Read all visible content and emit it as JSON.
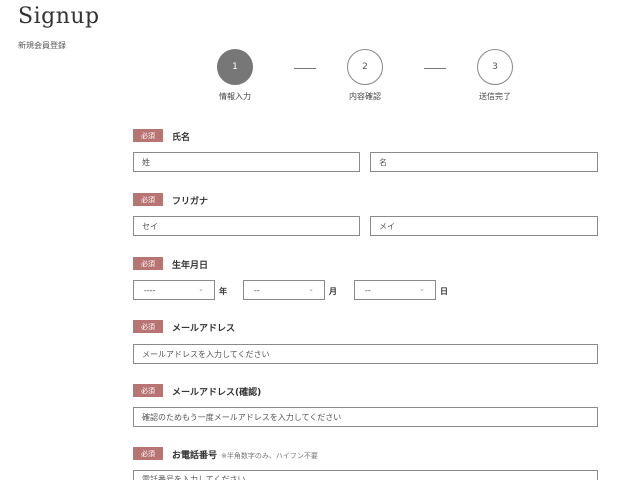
{
  "header": {
    "title": "Signup",
    "subtitle": "新規会員登録"
  },
  "stepper": {
    "steps": [
      {
        "number": "1",
        "label": "情報入力",
        "active": true
      },
      {
        "number": "2",
        "label": "内容確認",
        "active": false
      },
      {
        "number": "3",
        "label": "送信完了",
        "active": false
      }
    ]
  },
  "required_badge": "必須",
  "form": {
    "name": {
      "label": "氏名",
      "last_placeholder": "姓",
      "first_placeholder": "名"
    },
    "kana": {
      "label": "フリガナ",
      "last_placeholder": "セイ",
      "first_placeholder": "メイ"
    },
    "birthday": {
      "label": "生年月日",
      "year_value": "----",
      "year_unit": "年",
      "month_value": "--",
      "month_unit": "月",
      "day_value": "--",
      "day_unit": "日"
    },
    "email": {
      "label": "メールアドレス",
      "placeholder": "メールアドレスを入力してください"
    },
    "email_confirm": {
      "label": "メールアドレス(確認)",
      "placeholder": "確認のためもう一度メールアドレスを入力してください"
    },
    "phone": {
      "label": "お電話番号",
      "hint": "※半角数字のみ、ハイフン不要",
      "placeholder": "電話番号を入力してください"
    }
  },
  "colors": {
    "required_badge": "#b87373",
    "step_active": "#777777",
    "border": "#8a8a8a"
  }
}
